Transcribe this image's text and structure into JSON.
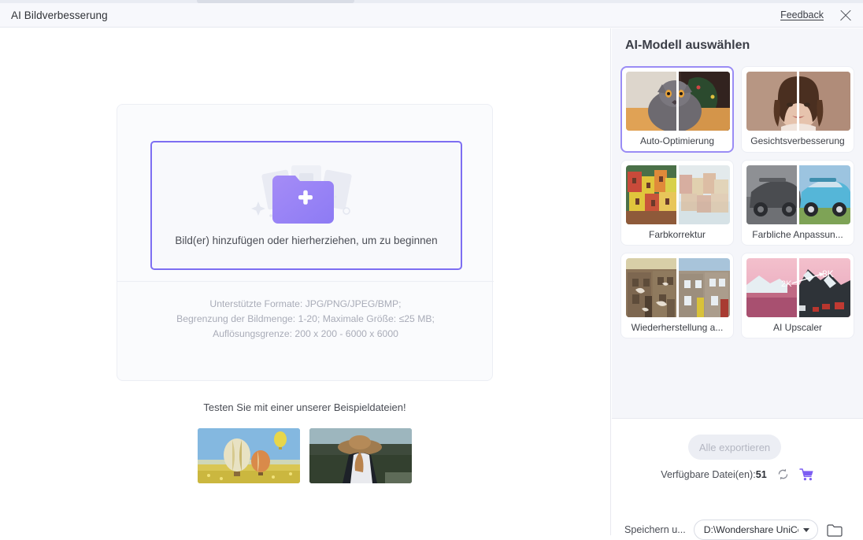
{
  "titlebar": {
    "app_title": "AI Bildverbesserung",
    "feedback_label": "Feedback",
    "close_icon": "close-icon"
  },
  "main": {
    "dropzone": {
      "text": "Bild(er) hinzufügen oder hierherziehen, um zu beginnen",
      "icon": "add-folder-icon",
      "border_color": "#7d6ef2"
    },
    "format_info": {
      "line1": "Unterstützte Formate: JPG/PNG/JPEG/BMP;",
      "line2": "Begrenzung der Bildmenge: 1-20; Maximale Größe: ≤25 MB;",
      "line3": "Auflösungsgrenze: 200 x 200 - 6000 x 6000"
    },
    "sample_hint": "Testen Sie mit einer unserer Beispieldateien!",
    "samples": [
      {
        "name": "hot-air-balloons"
      },
      {
        "name": "person-with-hat-overlook"
      }
    ]
  },
  "sidebar": {
    "heading": "AI-Modell auswählen",
    "accent_color": "#7d6ef2",
    "models": [
      {
        "label": "Auto-Optimierung",
        "name": "model-auto-optimization",
        "selected": true
      },
      {
        "label": "Gesichtsverbesserung",
        "name": "model-face-enhancement",
        "selected": false
      },
      {
        "label": "Farbkorrektur",
        "name": "model-color-correction",
        "selected": false
      },
      {
        "label": "Farbliche Anpassun...",
        "name": "model-colorize",
        "selected": false
      },
      {
        "label": "Wiederherstellung a...",
        "name": "model-old-photo-restoration",
        "selected": false
      },
      {
        "label": "AI Upscaler",
        "name": "model-ai-upscaler",
        "selected": false
      }
    ],
    "upscaler_badges": {
      "before": "2K",
      "after": "8K"
    }
  },
  "footer": {
    "export_label": "Alle exportieren",
    "files_label": "Verfügbare Datei(en):",
    "files_count": "51",
    "refresh_icon": "refresh-icon",
    "cart_icon": "cart-icon",
    "save_label": "Speichern u...",
    "save_path": "D:\\Wondershare UniCon",
    "folder_icon": "folder-open-icon"
  }
}
